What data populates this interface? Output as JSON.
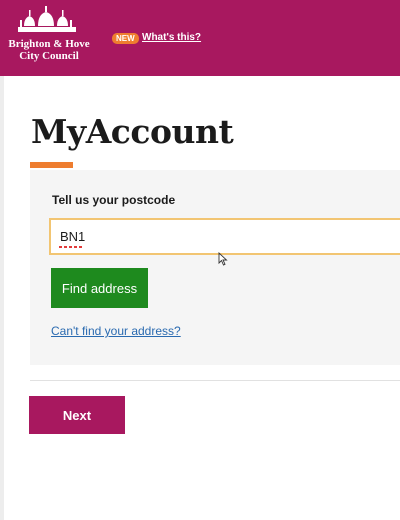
{
  "header": {
    "logo_text_line1": "Brighton & Hove",
    "logo_text_line2": "City Council",
    "new_badge": "NEW",
    "whats_this_link": "What's this?",
    "background_color": "#a8185f"
  },
  "main": {
    "title": "MyAccount",
    "accent_color": "#ee7d2f",
    "postcode_label": "Tell us your postcode",
    "postcode_value": "BN1",
    "find_address_button": "Find address",
    "cant_find_link": "Can't find your address?",
    "next_button": "Next"
  },
  "icons": {
    "logo": "pavilion-domes-icon",
    "cursor": "mouse-pointer-icon"
  }
}
